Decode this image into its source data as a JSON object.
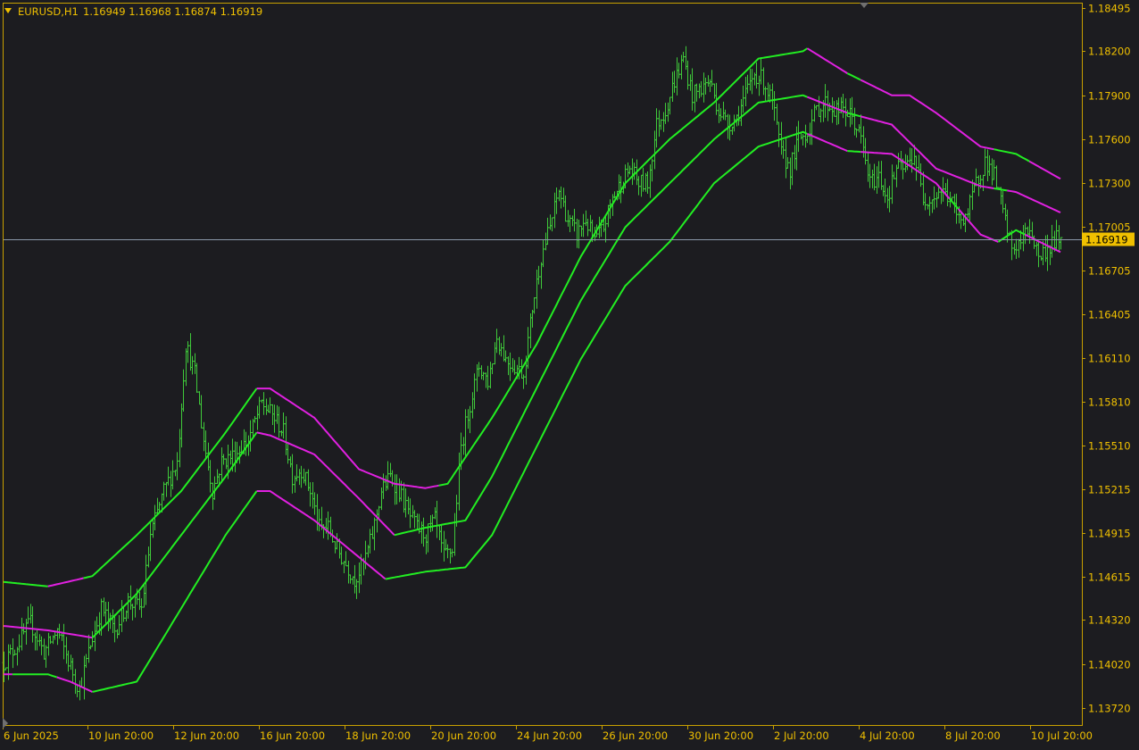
{
  "colors": {
    "background": "#1c1c20",
    "axis": "#c8a000",
    "text": "#f0c000",
    "bars": "#3fc93a",
    "band_up": "#22ee22",
    "band_down": "#e020e0",
    "price_line": "#8a96a8",
    "price_tag_bg": "#f0c000",
    "price_tag_text": "#000000"
  },
  "header": {
    "symbol_timeframe": "EURUSD,H1",
    "ohlc": "1.16949 1.16968 1.16874 1.16919",
    "arrow_icon": "triangle-down-icon"
  },
  "price_tag": {
    "value": "1.16919"
  },
  "chart_data": {
    "type": "line",
    "title": "",
    "symbol": "EURUSD",
    "timeframe": "H1",
    "y_ticks": [
      "1.18495",
      "1.18200",
      "1.17900",
      "1.17600",
      "1.17300",
      "1.17005",
      "1.16705",
      "1.16405",
      "1.16110",
      "1.15810",
      "1.15510",
      "1.15215",
      "1.14915",
      "1.14615",
      "1.14320",
      "1.14020",
      "1.13720"
    ],
    "x_ticks": [
      "6 Jun 2025",
      "10 Jun 20:00",
      "12 Jun 20:00",
      "16 Jun 20:00",
      "18 Jun 20:00",
      "20 Jun 20:00",
      "24 Jun 20:00",
      "26 Jun 20:00",
      "30 Jun 20:00",
      "2 Jul 20:00",
      "4 Jul 20:00",
      "8 Jul 20:00",
      "10 Jul 20:00"
    ],
    "ylim": [
      1.1372,
      1.18495
    ],
    "last_price": 1.16919,
    "grid": false,
    "price_path": [
      [
        0,
        1.1403
      ],
      [
        3,
        1.1415
      ],
      [
        6,
        1.143
      ],
      [
        9,
        1.141
      ],
      [
        12,
        1.1425
      ],
      [
        15,
        1.14
      ],
      [
        17,
        1.1385
      ],
      [
        19,
        1.141
      ],
      [
        22,
        1.144
      ],
      [
        25,
        1.1425
      ],
      [
        28,
        1.1445
      ],
      [
        31,
        1.144
      ],
      [
        33,
        1.149
      ],
      [
        36,
        1.152
      ],
      [
        39,
        1.154
      ],
      [
        41,
        1.162
      ],
      [
        43,
        1.16
      ],
      [
        45,
        1.1555
      ],
      [
        47,
        1.152
      ],
      [
        49,
        1.154
      ],
      [
        52,
        1.1545
      ],
      [
        55,
        1.1555
      ],
      [
        58,
        1.158
      ],
      [
        61,
        1.157
      ],
      [
        63,
        1.156
      ],
      [
        65,
        1.153
      ],
      [
        67,
        1.1535
      ],
      [
        69,
        1.152
      ],
      [
        71,
        1.1495
      ],
      [
        73,
        1.1495
      ],
      [
        75,
        1.148
      ],
      [
        77,
        1.147
      ],
      [
        79,
        1.146
      ],
      [
        81,
        1.147
      ],
      [
        83,
        1.149
      ],
      [
        85,
        1.152
      ],
      [
        87,
        1.153
      ],
      [
        89,
        1.152
      ],
      [
        91,
        1.1505
      ],
      [
        93,
        1.1495
      ],
      [
        95,
        1.149
      ],
      [
        97,
        1.15
      ],
      [
        99,
        1.1475
      ],
      [
        101,
        1.148
      ],
      [
        103,
        1.155
      ],
      [
        105,
        1.158
      ],
      [
        107,
        1.1605
      ],
      [
        109,
        1.1595
      ],
      [
        111,
        1.1625
      ],
      [
        113,
        1.161
      ],
      [
        115,
        1.1605
      ],
      [
        117,
        1.16
      ],
      [
        119,
        1.1645
      ],
      [
        121,
        1.168
      ],
      [
        123,
        1.17
      ],
      [
        125,
        1.1725
      ],
      [
        127,
        1.1705
      ],
      [
        129,
        1.1695
      ],
      [
        131,
        1.1705
      ],
      [
        133,
        1.169
      ],
      [
        135,
        1.17
      ],
      [
        137,
        1.172
      ],
      [
        139,
        1.173
      ],
      [
        141,
        1.174
      ],
      [
        143,
        1.173
      ],
      [
        145,
        1.173
      ],
      [
        147,
        1.177
      ],
      [
        149,
        1.178
      ],
      [
        151,
        1.18
      ],
      [
        153,
        1.1815
      ],
      [
        155,
        1.179
      ],
      [
        157,
        1.1795
      ],
      [
        159,
        1.18
      ],
      [
        161,
        1.178
      ],
      [
        163,
        1.177
      ],
      [
        165,
        1.1775
      ],
      [
        167,
        1.179
      ],
      [
        169,
        1.1805
      ],
      [
        171,
        1.18
      ],
      [
        173,
        1.1785
      ],
      [
        175,
        1.175
      ],
      [
        177,
        1.174
      ],
      [
        179,
        1.176
      ],
      [
        181,
        1.1765
      ],
      [
        183,
        1.178
      ],
      [
        185,
        1.1785
      ],
      [
        187,
        1.178
      ],
      [
        189,
        1.178
      ],
      [
        191,
        1.1775
      ],
      [
        193,
        1.176
      ],
      [
        195,
        1.173
      ],
      [
        197,
        1.1735
      ],
      [
        199,
        1.172
      ],
      [
        201,
        1.174
      ],
      [
        203,
        1.174
      ],
      [
        205,
        1.175
      ],
      [
        207,
        1.172
      ],
      [
        209,
        1.172
      ],
      [
        211,
        1.1725
      ],
      [
        213,
        1.172
      ],
      [
        215,
        1.1705
      ],
      [
        217,
        1.171
      ],
      [
        219,
        1.173
      ],
      [
        221,
        1.1745
      ],
      [
        223,
        1.1735
      ],
      [
        225,
        1.171
      ],
      [
        227,
        1.1685
      ],
      [
        229,
        1.169
      ],
      [
        231,
        1.17
      ],
      [
        233,
        1.168
      ],
      [
        235,
        1.1685
      ],
      [
        237,
        1.1692
      ]
    ],
    "series": [
      {
        "role": "upper-band",
        "values": [
          [
            0,
            1.1458
          ],
          [
            10,
            1.1455
          ],
          [
            20,
            1.1462
          ],
          [
            30,
            1.149
          ],
          [
            40,
            1.152
          ],
          [
            50,
            1.156
          ],
          [
            57,
            1.159
          ],
          [
            60,
            1.159
          ],
          [
            70,
            1.157
          ],
          [
            80,
            1.1535
          ],
          [
            88,
            1.1525
          ],
          [
            95,
            1.1522
          ],
          [
            100,
            1.1525
          ],
          [
            110,
            1.157
          ],
          [
            120,
            1.162
          ],
          [
            130,
            1.168
          ],
          [
            140,
            1.173
          ],
          [
            150,
            1.176
          ],
          [
            160,
            1.1785
          ],
          [
            170,
            1.1815
          ],
          [
            180,
            1.182
          ],
          [
            181,
            1.1822
          ],
          [
            190,
            1.1805
          ],
          [
            200,
            1.179
          ],
          [
            204,
            1.179
          ],
          [
            210,
            1.1778
          ],
          [
            220,
            1.1755
          ],
          [
            228,
            1.175
          ],
          [
            238,
            1.1733
          ]
        ],
        "dir": [
          [
            0,
            "up"
          ],
          [
            10,
            "down"
          ],
          [
            18,
            "up"
          ],
          [
            57,
            "down"
          ],
          [
            98,
            "up"
          ],
          [
            181,
            "down"
          ],
          [
            190,
            "up"
          ],
          [
            193,
            "down"
          ],
          [
            223,
            "up"
          ],
          [
            231,
            "down"
          ]
        ]
      },
      {
        "role": "middle-band",
        "values": [
          [
            0,
            1.1428
          ],
          [
            10,
            1.1425
          ],
          [
            20,
            1.142
          ],
          [
            30,
            1.145
          ],
          [
            40,
            1.149
          ],
          [
            50,
            1.153
          ],
          [
            57,
            1.156
          ],
          [
            60,
            1.1558
          ],
          [
            70,
            1.1545
          ],
          [
            80,
            1.1515
          ],
          [
            88,
            1.149
          ],
          [
            95,
            1.1495
          ],
          [
            104,
            1.15
          ],
          [
            110,
            1.153
          ],
          [
            120,
            1.159
          ],
          [
            130,
            1.165
          ],
          [
            140,
            1.17
          ],
          [
            150,
            1.173
          ],
          [
            160,
            1.176
          ],
          [
            170,
            1.1785
          ],
          [
            180,
            1.179
          ],
          [
            190,
            1.1778
          ],
          [
            200,
            1.177
          ],
          [
            210,
            1.174
          ],
          [
            220,
            1.1728
          ],
          [
            228,
            1.1724
          ],
          [
            238,
            1.171
          ]
        ],
        "dir": [
          [
            0,
            "down"
          ],
          [
            20,
            "up"
          ],
          [
            57,
            "down"
          ],
          [
            88,
            "up"
          ],
          [
            181,
            "down"
          ],
          [
            190,
            "up"
          ],
          [
            193,
            "down"
          ],
          [
            223,
            "up"
          ],
          [
            226,
            "down"
          ]
        ]
      },
      {
        "role": "lower-band",
        "values": [
          [
            0,
            1.1395
          ],
          [
            10,
            1.1395
          ],
          [
            15,
            1.139
          ],
          [
            20,
            1.1383
          ],
          [
            30,
            1.139
          ],
          [
            40,
            1.144
          ],
          [
            50,
            1.149
          ],
          [
            57,
            1.152
          ],
          [
            60,
            1.152
          ],
          [
            70,
            1.15
          ],
          [
            80,
            1.1475
          ],
          [
            86,
            1.146
          ],
          [
            95,
            1.1465
          ],
          [
            104,
            1.1468
          ],
          [
            110,
            1.149
          ],
          [
            120,
            1.155
          ],
          [
            130,
            1.161
          ],
          [
            140,
            1.166
          ],
          [
            150,
            1.169
          ],
          [
            160,
            1.173
          ],
          [
            170,
            1.1755
          ],
          [
            180,
            1.1765
          ],
          [
            190,
            1.1752
          ],
          [
            200,
            1.175
          ],
          [
            210,
            1.173
          ],
          [
            220,
            1.1695
          ],
          [
            224,
            1.169
          ],
          [
            228,
            1.1698
          ],
          [
            238,
            1.1683
          ]
        ],
        "dir": [
          [
            0,
            "down"
          ],
          [
            2,
            "up"
          ],
          [
            12,
            "down"
          ],
          [
            20,
            "up"
          ],
          [
            57,
            "down"
          ],
          [
            86,
            "up"
          ],
          [
            181,
            "down"
          ],
          [
            190,
            "up"
          ],
          [
            193,
            "down"
          ],
          [
            213,
            "up"
          ],
          [
            215,
            "down"
          ],
          [
            224,
            "up"
          ],
          [
            230,
            "down"
          ]
        ]
      }
    ]
  }
}
